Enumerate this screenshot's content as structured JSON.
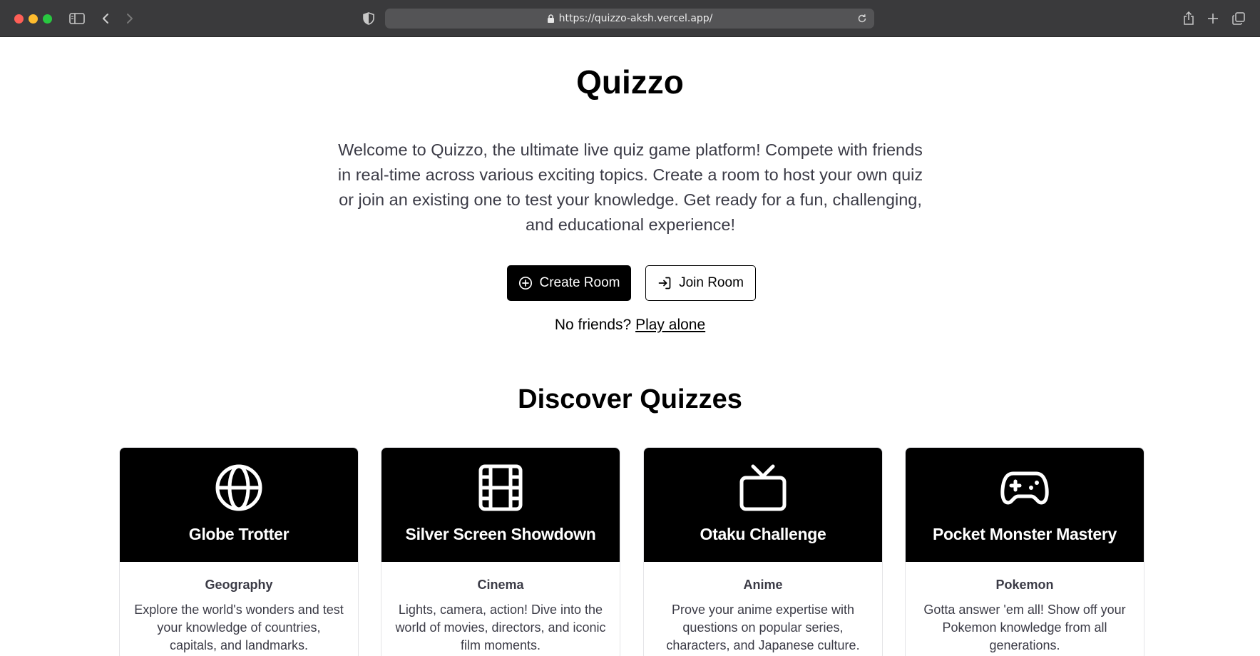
{
  "browser": {
    "url": "https://quizzo-aksh.vercel.app/"
  },
  "page": {
    "title": "Quizzo",
    "intro": "Welcome to Quizzo, the ultimate live quiz game platform! Compete with friends in real-time across various exciting topics. Create a room to host your own quiz or join an existing one to test your knowledge. Get ready for a fun, challenging, and educational experience!",
    "create_room_label": "Create Room",
    "join_room_label": "Join Room",
    "no_friends_text": "No friends?",
    "play_alone_label": "Play alone",
    "discover_title": "Discover Quizzes"
  },
  "quizzes": [
    {
      "title": "Globe Trotter",
      "category": "Geography",
      "description": "Explore the world's wonders and test your knowledge of countries, capitals, and landmarks.",
      "icon": "globe-icon"
    },
    {
      "title": "Silver Screen Showdown",
      "category": "Cinema",
      "description": "Lights, camera, action! Dive into the world of movies, directors, and iconic film moments.",
      "icon": "film-icon"
    },
    {
      "title": "Otaku Challenge",
      "category": "Anime",
      "description": "Prove your anime expertise with questions on popular series, characters, and Japanese culture.",
      "icon": "tv-icon"
    },
    {
      "title": "Pocket Monster Mastery",
      "category": "Pokemon",
      "description": "Gotta answer 'em all! Show off your Pokemon knowledge from all generations.",
      "icon": "gamepad-icon"
    }
  ]
}
